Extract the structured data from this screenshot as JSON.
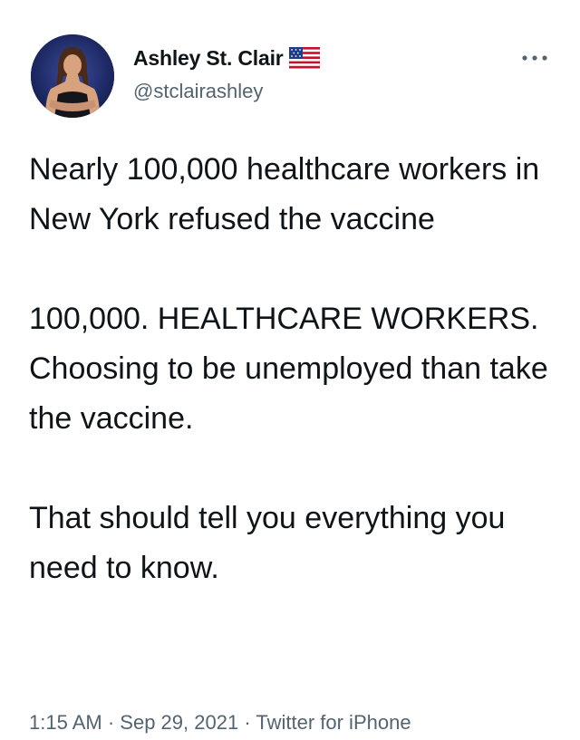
{
  "author": {
    "display_name": "Ashley St. Clair",
    "handle": "@stclairashley",
    "flag_icon": "us-flag-icon",
    "avatar_icon": "profile-avatar"
  },
  "menu": {
    "more_icon": "more-dots-icon"
  },
  "tweet": {
    "paragraphs": [
      "Nearly 100,000 healthcare workers in New York refused the vaccine",
      "100,000. HEALTHCARE WORKERS. Choosing to be unemployed than take the vaccine.",
      "That should tell you everything you need to know."
    ]
  },
  "meta": {
    "time": "1:15 AM",
    "separator": "·",
    "date": "Sep 29, 2021",
    "source": "Twitter for iPhone"
  },
  "colors": {
    "text": "#0f1419",
    "secondary": "#536471",
    "avatar_bg": "#1e2a66"
  }
}
